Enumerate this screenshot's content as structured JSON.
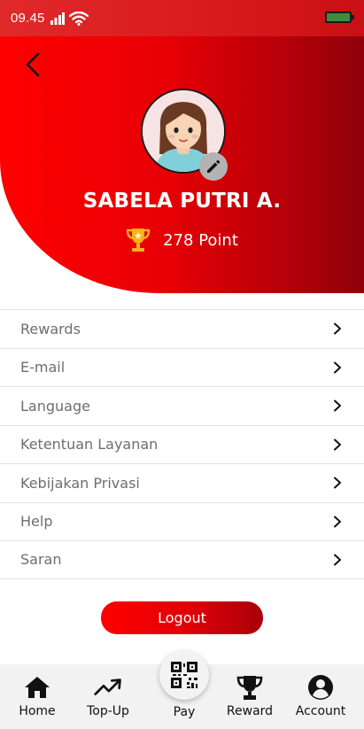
{
  "status_bar": {
    "time": "09.45"
  },
  "profile": {
    "name": "SABELA PUTRI A.",
    "points": "278 Point"
  },
  "menu": {
    "items": [
      {
        "label": "Rewards"
      },
      {
        "label": "E-mail"
      },
      {
        "label": "Language"
      },
      {
        "label": "Ketentuan Layanan"
      },
      {
        "label": "Kebijakan Privasi"
      },
      {
        "label": "Help"
      },
      {
        "label": "Saran"
      }
    ]
  },
  "logout_label": "Logout",
  "bottom_nav": {
    "items": [
      {
        "label": "Home",
        "icon": "home-icon"
      },
      {
        "label": "Top-Up",
        "icon": "trending-up-icon"
      },
      {
        "label": "Pay",
        "icon": "qr-code-icon"
      },
      {
        "label": "Reward",
        "icon": "trophy-icon"
      },
      {
        "label": "Account",
        "icon": "account-icon"
      }
    ]
  },
  "colors": {
    "brand_red": "#e70006",
    "brand_dark_red": "#8f0009",
    "menu_text": "#6e6e6e"
  }
}
